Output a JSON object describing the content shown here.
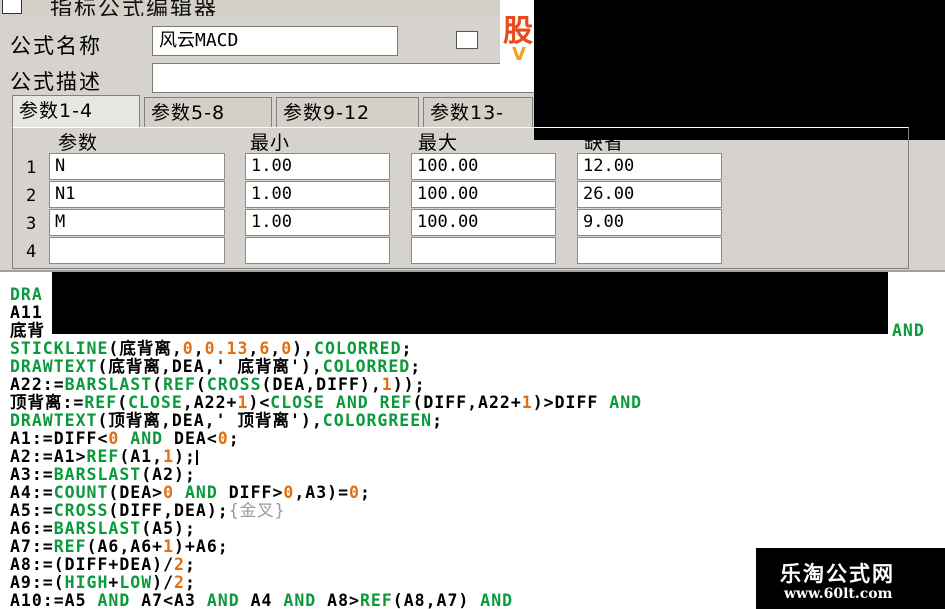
{
  "window": {
    "title": "指标公式编辑器"
  },
  "form": {
    "name_label": "公式名称",
    "name_value": "风云MACD",
    "desc_label": "公式描述",
    "desc_value": ""
  },
  "ad": {
    "glyph_top": "股",
    "glyph_bottom": "V"
  },
  "tabs": [
    {
      "label": "参数1-4",
      "active": true
    },
    {
      "label": "参数5-8",
      "active": false
    },
    {
      "label": "参数9-12",
      "active": false
    },
    {
      "label": "参数13-",
      "active": false
    }
  ],
  "params": {
    "headers": [
      "参数",
      "最小",
      "最大",
      "缺省"
    ],
    "rows": [
      {
        "num": "1",
        "name": "N",
        "min": "1.00",
        "max": "100.00",
        "default": "12.00"
      },
      {
        "num": "2",
        "name": "N1",
        "min": "1.00",
        "max": "100.00",
        "default": "26.00"
      },
      {
        "num": "3",
        "name": "M",
        "min": "1.00",
        "max": "100.00",
        "default": "9.00"
      },
      {
        "num": "4",
        "name": "",
        "min": "",
        "max": "",
        "default": ""
      }
    ]
  },
  "code": {
    "lines": [
      [
        {
          "t": "DRA",
          "c": "f"
        }
      ],
      [
        {
          "t": "A11",
          "c": "k"
        }
      ],
      [
        {
          "t": "底背",
          "c": "k"
        },
        {
          "t": "AND",
          "c": "a"
        }
      ],
      [
        {
          "t": "STICKLINE",
          "c": "f"
        },
        {
          "t": "(底背离,",
          "c": "k"
        },
        {
          "t": "0",
          "c": "n"
        },
        {
          "t": ",",
          "c": "k"
        },
        {
          "t": "0.13",
          "c": "n"
        },
        {
          "t": ",",
          "c": "k"
        },
        {
          "t": "6",
          "c": "n"
        },
        {
          "t": ",",
          "c": "k"
        },
        {
          "t": "0",
          "c": "n"
        },
        {
          "t": "),",
          "c": "k"
        },
        {
          "t": "COLORRED",
          "c": "f"
        },
        {
          "t": ";",
          "c": "k"
        }
      ],
      [
        {
          "t": "DRAWTEXT",
          "c": "f"
        },
        {
          "t": "(底背离,DEA,' 底背离'),",
          "c": "k"
        },
        {
          "t": "COLORRED",
          "c": "f"
        },
        {
          "t": ";",
          "c": "k"
        }
      ],
      [
        {
          "t": "A22:=",
          "c": "k"
        },
        {
          "t": "BARSLAST",
          "c": "f"
        },
        {
          "t": "(",
          "c": "k"
        },
        {
          "t": "REF",
          "c": "f"
        },
        {
          "t": "(",
          "c": "k"
        },
        {
          "t": "CROSS",
          "c": "f"
        },
        {
          "t": "(DEA,DIFF),",
          "c": "k"
        },
        {
          "t": "1",
          "c": "n"
        },
        {
          "t": "));",
          "c": "k"
        }
      ],
      [
        {
          "t": "顶背离:=",
          "c": "k"
        },
        {
          "t": "REF",
          "c": "f"
        },
        {
          "t": "(",
          "c": "k"
        },
        {
          "t": "CLOSE",
          "c": "f"
        },
        {
          "t": ",A22+",
          "c": "k"
        },
        {
          "t": "1",
          "c": "n"
        },
        {
          "t": ")<",
          "c": "k"
        },
        {
          "t": "CLOSE",
          "c": "f"
        },
        {
          "t": " ",
          "c": "k"
        },
        {
          "t": "AND",
          "c": "a"
        },
        {
          "t": " ",
          "c": "k"
        },
        {
          "t": "REF",
          "c": "f"
        },
        {
          "t": "(DIFF,A22+",
          "c": "k"
        },
        {
          "t": "1",
          "c": "n"
        },
        {
          "t": ")>DIFF ",
          "c": "k"
        },
        {
          "t": "AND",
          "c": "a"
        }
      ],
      [
        {
          "t": "DRAWTEXT",
          "c": "f"
        },
        {
          "t": "(顶背离,DEA,' 顶背离'),",
          "c": "k"
        },
        {
          "t": "COLORGREEN",
          "c": "f"
        },
        {
          "t": ";",
          "c": "k"
        }
      ],
      [
        {
          "t": "A1:=DIFF<",
          "c": "k"
        },
        {
          "t": "0",
          "c": "n"
        },
        {
          "t": " ",
          "c": "k"
        },
        {
          "t": "AND",
          "c": "a"
        },
        {
          "t": " DEA<",
          "c": "k"
        },
        {
          "t": "0",
          "c": "n"
        },
        {
          "t": ";",
          "c": "k"
        }
      ],
      [
        {
          "t": "A2:=A1>",
          "c": "k"
        },
        {
          "t": "REF",
          "c": "f"
        },
        {
          "t": "(A1,",
          "c": "k"
        },
        {
          "t": "1",
          "c": "n"
        },
        {
          "t": ");",
          "c": "k"
        },
        {
          "t": "|",
          "c": "caret"
        }
      ],
      [
        {
          "t": "A3:=",
          "c": "k"
        },
        {
          "t": "BARSLAST",
          "c": "f"
        },
        {
          "t": "(A2);",
          "c": "k"
        }
      ],
      [
        {
          "t": "A4:=",
          "c": "k"
        },
        {
          "t": "COUNT",
          "c": "f"
        },
        {
          "t": "(DEA>",
          "c": "k"
        },
        {
          "t": "0",
          "c": "n"
        },
        {
          "t": " ",
          "c": "k"
        },
        {
          "t": "AND",
          "c": "a"
        },
        {
          "t": " DIFF>",
          "c": "k"
        },
        {
          "t": "0",
          "c": "n"
        },
        {
          "t": ",A3)=",
          "c": "k"
        },
        {
          "t": "0",
          "c": "n"
        },
        {
          "t": ";",
          "c": "k"
        }
      ],
      [
        {
          "t": "A5:=",
          "c": "k"
        },
        {
          "t": "CROSS",
          "c": "f"
        },
        {
          "t": "(DIFF,DEA);",
          "c": "k"
        },
        {
          "t": "{金叉}",
          "c": "c"
        }
      ],
      [
        {
          "t": "A6:=",
          "c": "k"
        },
        {
          "t": "BARSLAST",
          "c": "f"
        },
        {
          "t": "(A5);",
          "c": "k"
        }
      ],
      [
        {
          "t": "A7:=",
          "c": "k"
        },
        {
          "t": "REF",
          "c": "f"
        },
        {
          "t": "(A6,A6+",
          "c": "k"
        },
        {
          "t": "1",
          "c": "n"
        },
        {
          "t": ")+A6;",
          "c": "k"
        }
      ],
      [
        {
          "t": "A8:=(DIFF+DEA)/",
          "c": "k"
        },
        {
          "t": "2",
          "c": "n"
        },
        {
          "t": ";",
          "c": "k"
        }
      ],
      [
        {
          "t": "A9:=(",
          "c": "k"
        },
        {
          "t": "HIGH",
          "c": "f"
        },
        {
          "t": "+",
          "c": "k"
        },
        {
          "t": "LOW",
          "c": "f"
        },
        {
          "t": ")/",
          "c": "k"
        },
        {
          "t": "2",
          "c": "n"
        },
        {
          "t": ";",
          "c": "k"
        }
      ],
      [
        {
          "t": "A10:=A5 ",
          "c": "k"
        },
        {
          "t": "AND",
          "c": "a"
        },
        {
          "t": " A7<A3 ",
          "c": "k"
        },
        {
          "t": "AND",
          "c": "a"
        },
        {
          "t": " A4 ",
          "c": "k"
        },
        {
          "t": "AND",
          "c": "a"
        },
        {
          "t": " A8>",
          "c": "k"
        },
        {
          "t": "REF",
          "c": "f"
        },
        {
          "t": "(A8,A7) ",
          "c": "k"
        },
        {
          "t": "AND",
          "c": "a"
        }
      ]
    ]
  },
  "watermark": {
    "name": "乐淘公式网",
    "url": "www.60lt.com"
  }
}
